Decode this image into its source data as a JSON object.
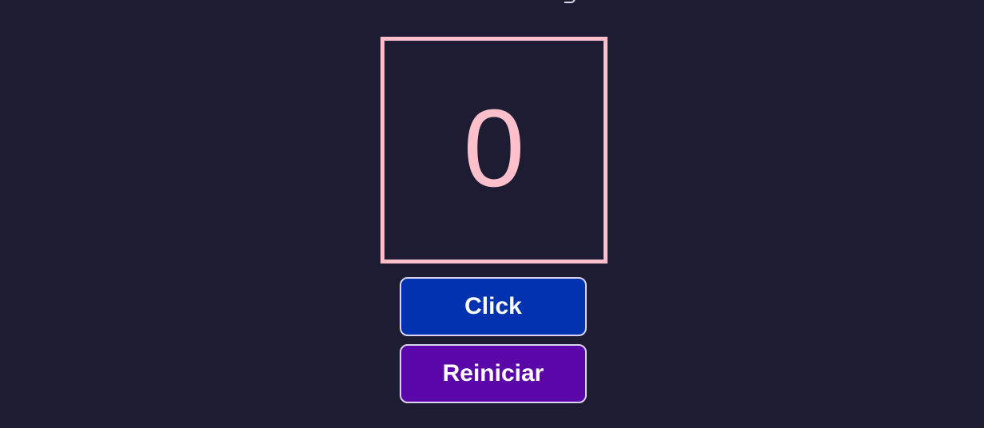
{
  "counter": {
    "value": "0"
  },
  "buttons": {
    "click_label": "Click",
    "reset_label": "Reiniciar"
  },
  "colors": {
    "background": "#1e1c33",
    "counter_accent": "#ffc0cb",
    "click_button": "#0232b0",
    "reset_button": "#5a06a8"
  }
}
